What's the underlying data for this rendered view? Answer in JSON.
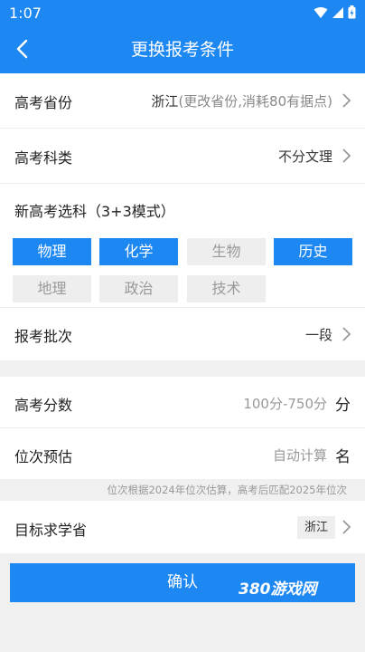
{
  "status_bar": {
    "time": "1:07"
  },
  "header": {
    "title": "更换报考条件"
  },
  "form": {
    "province": {
      "label": "高考省份",
      "value": "浙江",
      "hint": "(更改省份,消耗80有据点)"
    },
    "subject_type": {
      "label": "高考科类",
      "value": "不分文理"
    },
    "elective": {
      "label": "新高考选科（3+3模式）",
      "options": [
        {
          "label": "物理",
          "selected": true
        },
        {
          "label": "化学",
          "selected": true
        },
        {
          "label": "生物",
          "selected": false
        },
        {
          "label": "历史",
          "selected": true
        },
        {
          "label": "地理",
          "selected": false
        },
        {
          "label": "政治",
          "selected": false
        },
        {
          "label": "技术",
          "selected": false
        }
      ]
    },
    "batch": {
      "label": "报考批次",
      "value": "一段"
    },
    "score": {
      "label": "高考分数",
      "placeholder": "100分-750分",
      "unit": "分"
    },
    "rank": {
      "label": "位次预估",
      "placeholder": "自动计算",
      "unit": "名"
    },
    "rank_note": "位次根据2024年位次估算，高考后匹配2025年位次",
    "target_province": {
      "label": "目标求学省",
      "value": "浙江"
    }
  },
  "confirm_label": "确认",
  "watermark": "380游戏网",
  "colors": {
    "accent": "#1e88f2",
    "chip_off": "#eeeeee"
  }
}
